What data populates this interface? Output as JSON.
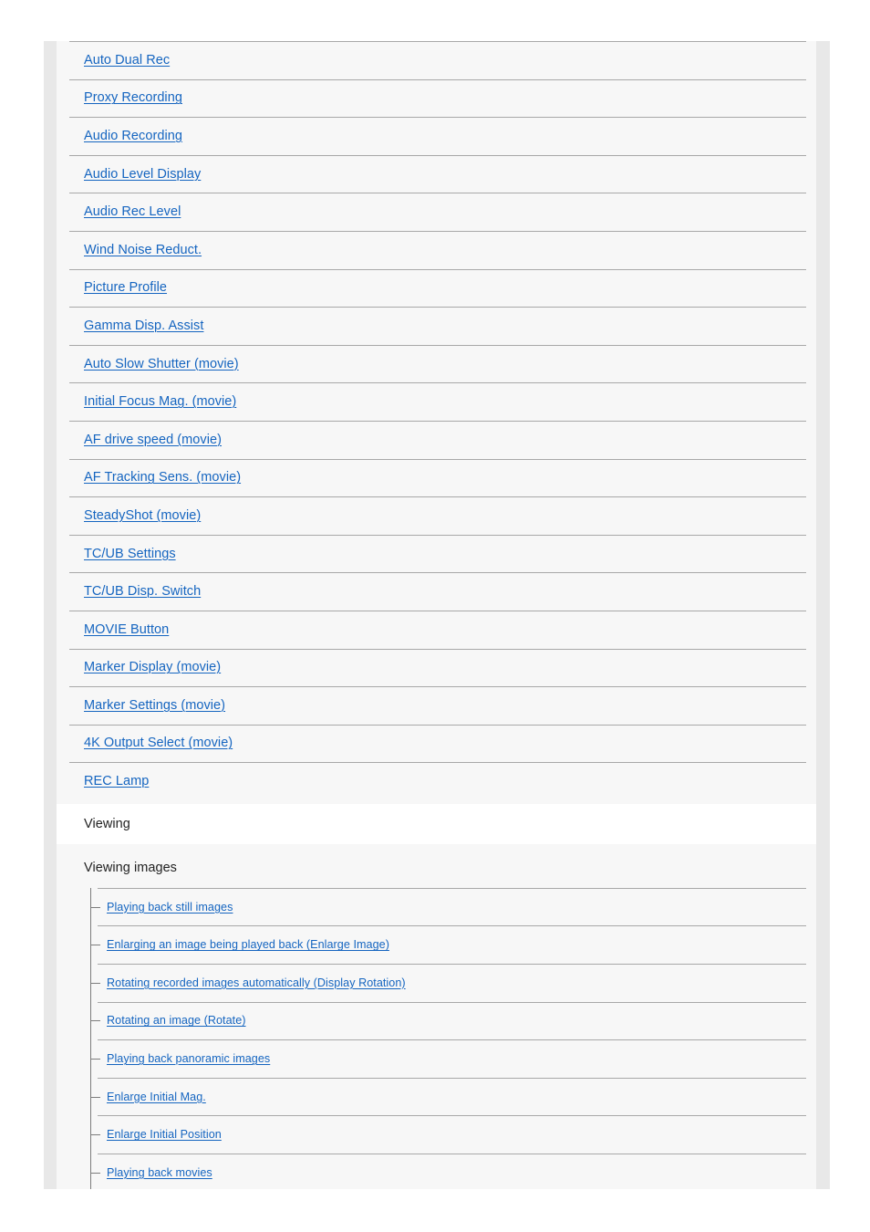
{
  "colors": {
    "link": "#1565c0",
    "text": "#222222",
    "content_bg": "#f7f7f7",
    "gutter_bg": "#e8e8e8",
    "band_bg": "#ffffff",
    "divider": "#a8a8a8",
    "tree_line": "#7d7d7d"
  },
  "toc": {
    "shooting_items": [
      {
        "label": "Auto Dual Rec"
      },
      {
        "label": "Proxy Recording"
      },
      {
        "label": "Audio Recording"
      },
      {
        "label": "Audio Level Display"
      },
      {
        "label": "Audio Rec Level"
      },
      {
        "label": "Wind Noise Reduct."
      },
      {
        "label": "Picture Profile"
      },
      {
        "label": "Gamma Disp. Assist"
      },
      {
        "label": "Auto Slow Shutter (movie)"
      },
      {
        "label": "Initial Focus Mag. (movie)"
      },
      {
        "label": "AF drive speed (movie)"
      },
      {
        "label": "AF Tracking Sens. (movie)"
      },
      {
        "label": "SteadyShot (movie)"
      },
      {
        "label": "TC/UB Settings"
      },
      {
        "label": "TC/UB Disp. Switch"
      },
      {
        "label": "MOVIE Button"
      },
      {
        "label": "Marker Display (movie)"
      },
      {
        "label": "Marker Settings (movie)"
      },
      {
        "label": "4K Output Select (movie)"
      },
      {
        "label": "REC Lamp"
      }
    ],
    "section": {
      "title": "Viewing"
    },
    "group": {
      "title": "Viewing images"
    },
    "viewing_items": [
      {
        "label": "Playing back still images"
      },
      {
        "label": "Enlarging an image being played back (Enlarge Image)"
      },
      {
        "label": "Rotating recorded images automatically (Display Rotation)"
      },
      {
        "label": "Rotating an image (Rotate)"
      },
      {
        "label": "Playing back panoramic images"
      },
      {
        "label": "Enlarge Initial Mag."
      },
      {
        "label": "Enlarge Initial Position"
      },
      {
        "label": "Playing back movies"
      }
    ]
  }
}
